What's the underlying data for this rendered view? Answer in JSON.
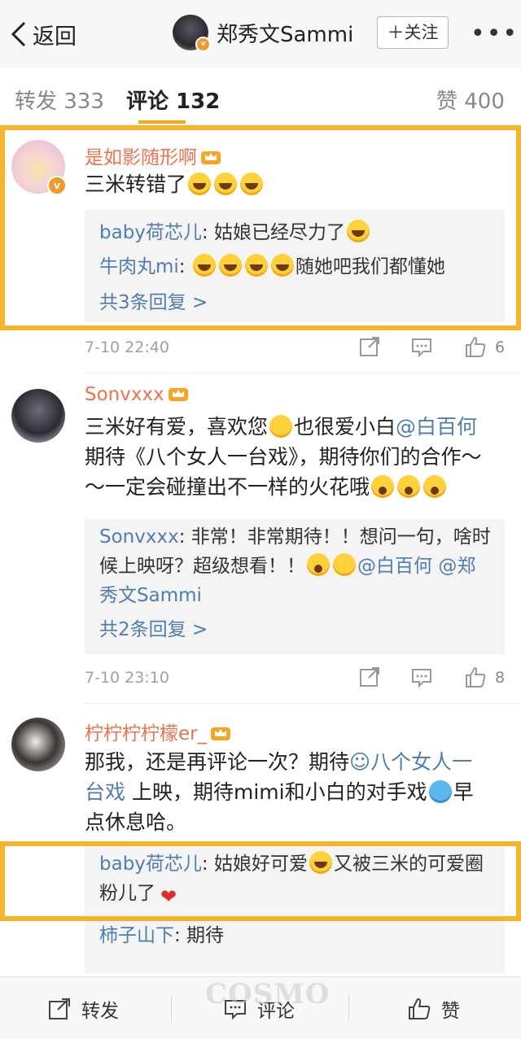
{
  "header": {
    "back_label": "返回",
    "title": "郑秀文Sammi",
    "follow_label": "＋关注",
    "more_label": "•••",
    "verified_badge": "v"
  },
  "tabs": {
    "repost": "转发 333",
    "comment": "评论 132",
    "like": "赞 400"
  },
  "comments": [
    {
      "user": "是如影随形啊",
      "text": "三米转错了",
      "replies": [
        {
          "name": "baby荷芯儿",
          "text": ": 姑娘已经尽力了"
        },
        {
          "name": "牛肉丸mi",
          "text": ": 随她吧我们都懂她"
        }
      ],
      "more_replies": "共3条回复 >",
      "time": "7-10 22:40",
      "likes": "6"
    },
    {
      "user": "Sonvxxx",
      "text_a": "三米好有爱，喜欢您",
      "text_b": "也很爱小白",
      "mention": "@白百何",
      "text_c": "期待《八个女人一台戏》，期待你们的合作～～一定会碰撞出不一样的火花哦",
      "replies": [
        {
          "name": "Sonvxxx",
          "text": ": 非常！非常期待！！想问一句，啥时候上映呀？超级想看！！"
        },
        {
          "mention1": "@白百何",
          "mention2": "@郑秀文Sammi"
        }
      ],
      "more_replies": "共2条回复 >",
      "time": "7-10 23:10",
      "likes": "8"
    },
    {
      "user": "柠柠柠柠檬er_",
      "text_a": "那我，还是再评论一次？期待",
      "topic": "八个女人一台戏",
      "text_b": "上映，期待mimi和小白的对手戏",
      "text_c": "早点休息哈。",
      "replies": [
        {
          "name": "baby荷芯儿",
          "text_a": ": 姑娘好可爱",
          "text_b": "又被三米的可爱圈粉儿了"
        },
        {
          "name": "柿子山下",
          "text": ": 期待"
        }
      ]
    }
  ],
  "bottom": {
    "repost": "转发",
    "comment": "评论",
    "like": "赞"
  },
  "watermark": "COSMO",
  "colors": {
    "accent": "#f6a623",
    "highlight": "#f5b42a",
    "link": "#507daf",
    "username": "#eb7350"
  }
}
